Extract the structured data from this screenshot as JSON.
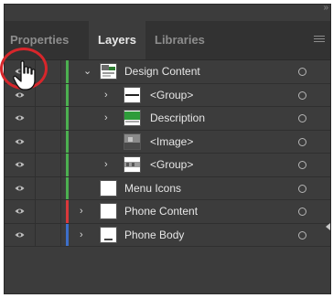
{
  "panel": {
    "collapse_glyph": "»",
    "tabs": [
      {
        "label": "Properties",
        "active": false
      },
      {
        "label": "Layers",
        "active": true
      },
      {
        "label": "Libraries",
        "active": false
      }
    ],
    "menu_icon": "hamburger-menu-icon"
  },
  "layers": [
    {
      "name": "Design Content",
      "expanded": true,
      "indent": 0,
      "color": "#4caf50",
      "thumb": "design"
    },
    {
      "name": "<Group>",
      "expanded": false,
      "indent": 1,
      "color": "#4caf50",
      "thumb": "group1"
    },
    {
      "name": "Description",
      "expanded": false,
      "indent": 1,
      "color": "#4caf50",
      "thumb": "description"
    },
    {
      "name": "<Image>",
      "expanded": null,
      "indent": 1,
      "color": "#4caf50",
      "thumb": "image"
    },
    {
      "name": "<Group>",
      "expanded": false,
      "indent": 1,
      "color": "#4caf50",
      "thumb": "group2"
    },
    {
      "name": "Menu Icons",
      "expanded": null,
      "indent": 0,
      "color": "#4caf50",
      "thumb": "blank"
    },
    {
      "name": "Phone Content",
      "expanded": false,
      "indent": 0,
      "color": "#d9383b",
      "thumb": "blank"
    },
    {
      "name": "Phone Body",
      "expanded": false,
      "indent": 0,
      "color": "#3d6fc9",
      "thumb": "phone"
    }
  ],
  "colors": {
    "panel_bg": "#3c3c3c",
    "callout": "#d7262b"
  }
}
